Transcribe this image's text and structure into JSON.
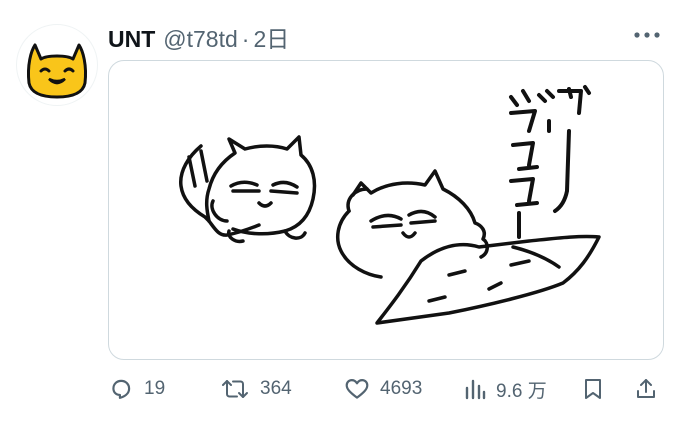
{
  "tweet": {
    "author_name": "UNT",
    "author_handle": "@t78td",
    "separator": "·",
    "time": "2日",
    "avatar_icon": "cat-face-avatar",
    "more_icon": "more-horizontal-icon",
    "media_icon": "cat-illustration",
    "media_text": "ぐごー ぐごごー"
  },
  "actions": {
    "reply": {
      "icon": "reply-icon",
      "count": "19"
    },
    "retweet": {
      "icon": "retweet-icon",
      "count": "364"
    },
    "like": {
      "icon": "heart-icon",
      "count": "4693"
    },
    "views": {
      "icon": "analytics-icon",
      "count": "9.6 万"
    },
    "bookmark": {
      "icon": "bookmark-icon"
    },
    "share": {
      "icon": "share-icon"
    }
  },
  "colors": {
    "text": "#0f1419",
    "secondary": "#536471",
    "border": "#cfd9de",
    "avatar_yellow": "#f9c51a"
  }
}
